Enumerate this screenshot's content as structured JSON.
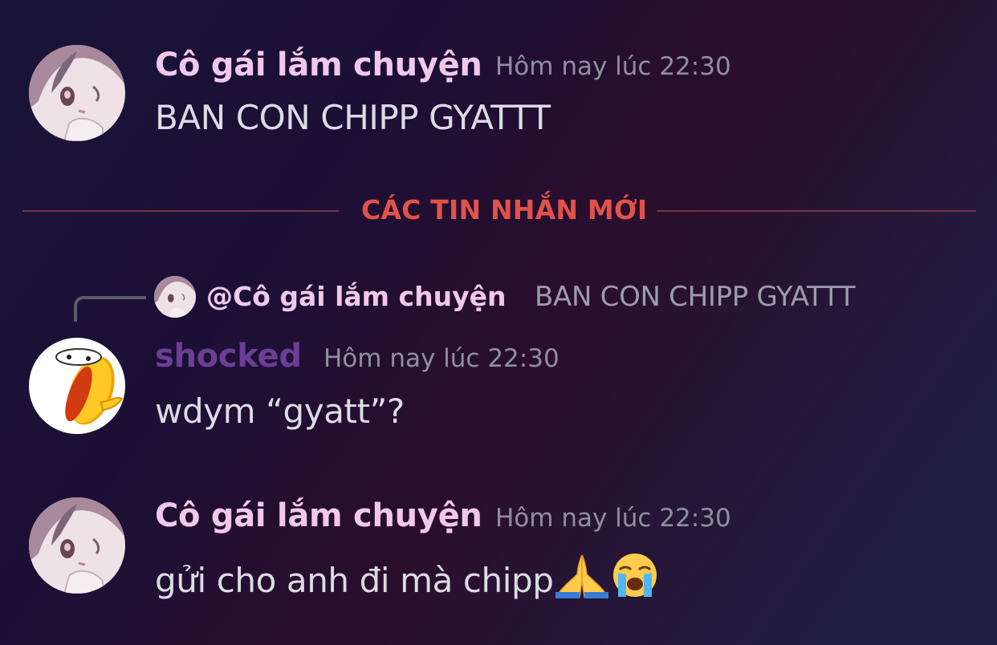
{
  "messages": [
    {
      "author": "Cô gái lắm chuyện",
      "timestamp": "Hôm nay lúc 22:30",
      "text": "BAN CON CHIPP GYATTT",
      "name_color": "#f1c8ec"
    },
    {
      "author": "shocked",
      "timestamp": "Hôm nay lúc 22:30",
      "text": "wdym “gyatt”?",
      "name_color": "#6b3f96",
      "reply": {
        "author": "@Cô gái lắm chuyện",
        "text": "BAN CON CHIPP GYATTT"
      }
    },
    {
      "author": "Cô gái lắm chuyện",
      "timestamp": "Hôm nay lúc 22:30",
      "text": "gửi cho anh đi mà chipp",
      "emojis": [
        "folded-hands-emoji",
        "loudly-crying-face-emoji"
      ],
      "name_color": "#f1c8ec"
    }
  ],
  "divider": {
    "label": "CÁC TIN NHẮN MỚI",
    "color": "#e0524a"
  }
}
